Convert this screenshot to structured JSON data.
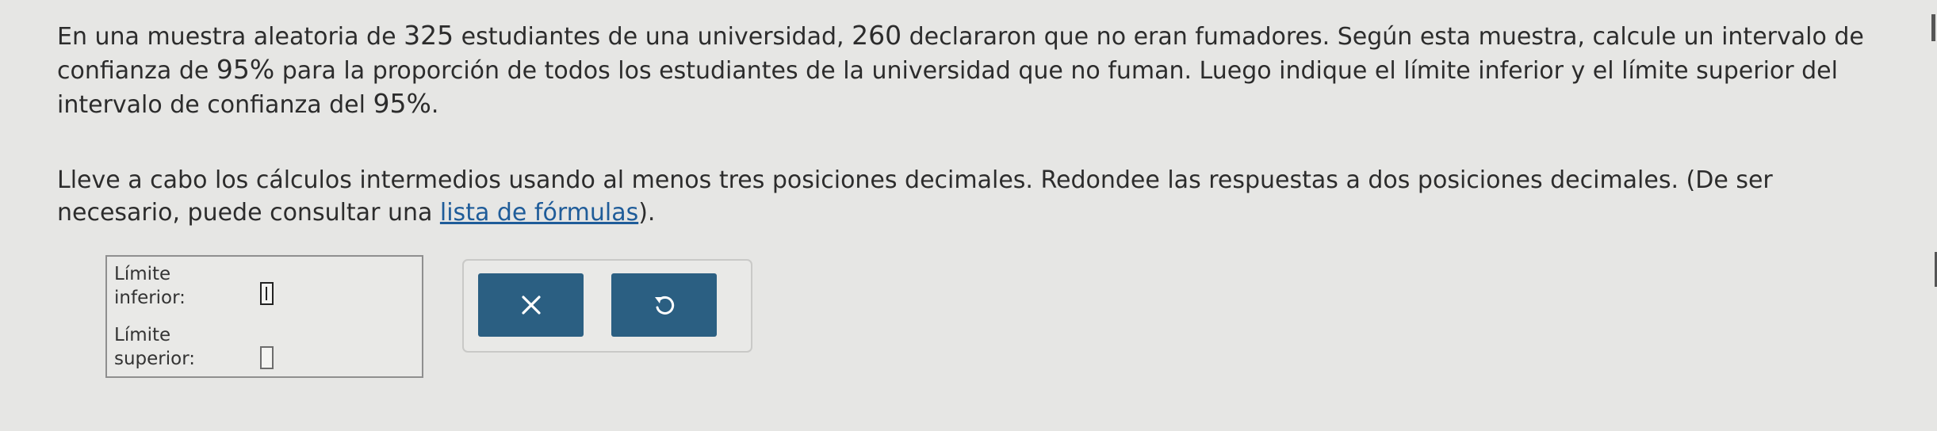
{
  "problem": {
    "p1_a": "En una muestra aleatoria de ",
    "n_total": "325",
    "p1_b": " estudiantes de una universidad, ",
    "n_nonsmokers": "260",
    "p1_c": " declararon que no eran fumadores. Según esta muestra, calcule un intervalo de confianza de ",
    "conf_level_1": "95%",
    "p1_d": " para la proporción de todos los estudiantes de la universidad que no fuman. Luego indique el límite inferior y el límite superior del intervalo de confianza del ",
    "conf_level_2": "95%",
    "p1_e": ".",
    "p2_a": "Lleve a cabo los cálculos intermedios usando al menos tres posiciones decimales. Redondee las respuestas a dos posiciones decimales. (De ser necesario, puede consultar una ",
    "formula_link": "lista de fórmulas",
    "p2_b": ")."
  },
  "answer": {
    "lower_label_1": "Límite",
    "lower_label_2": "inferior:",
    "lower_value": "",
    "upper_label_1": "Límite",
    "upper_label_2": "superior:",
    "upper_value": ""
  },
  "buttons": {
    "clear_icon": "x-icon",
    "undo_icon": "undo-icon"
  },
  "colors": {
    "background": "#e6e6e4",
    "button": "#2b5f82",
    "link": "#1f5c99"
  }
}
